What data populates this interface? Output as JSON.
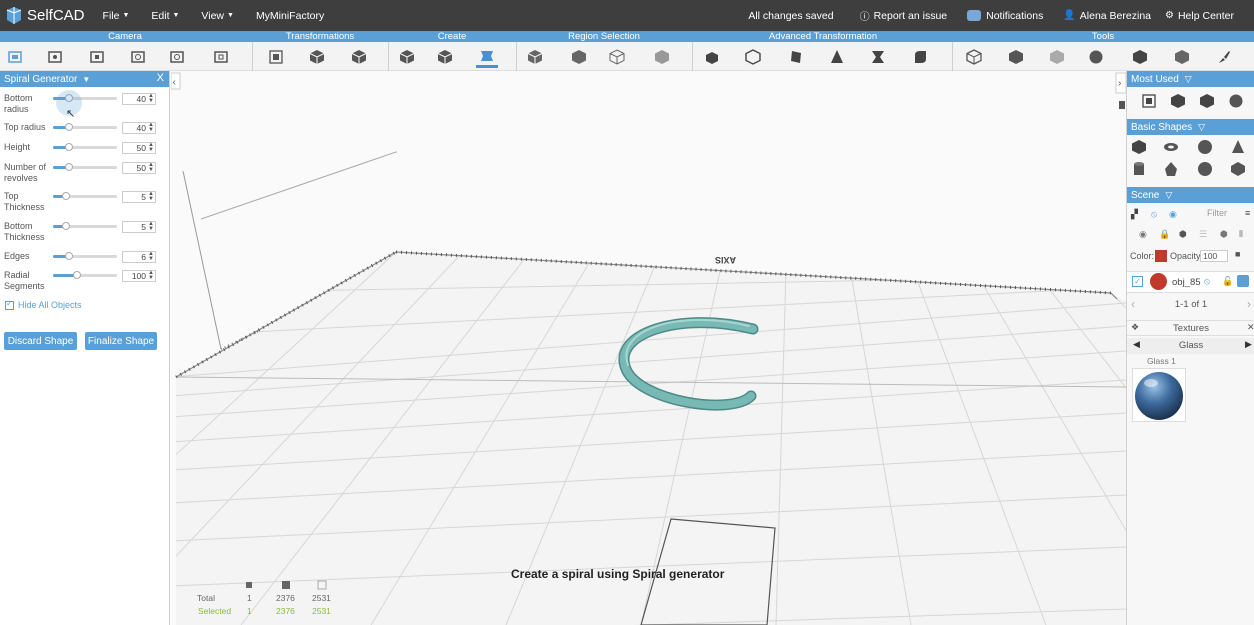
{
  "app": {
    "name": "SelfCAD"
  },
  "menu": [
    {
      "label": "File"
    },
    {
      "label": "Edit"
    },
    {
      "label": "View"
    },
    {
      "label": "MyMiniFactory"
    }
  ],
  "topright": {
    "saved": "All changes saved",
    "report": "Report an issue",
    "notifications": "Notifications",
    "user": "Alena Berezina",
    "help": "Help Center"
  },
  "categories": [
    "Camera",
    "Transformations",
    "Create",
    "Region Selection",
    "Advanced Transformation",
    "Tools"
  ],
  "left_panel": {
    "title": "Spiral Generator",
    "close": "X",
    "params": [
      {
        "label": "Bottom radius",
        "value": "40",
        "fill": 0.25
      },
      {
        "label": "Top radius",
        "value": "40",
        "fill": 0.25
      },
      {
        "label": "Height",
        "value": "50",
        "fill": 0.25
      },
      {
        "label": "Number of revolves",
        "value": "50",
        "fill": 0.25
      },
      {
        "label": "Top Thickness",
        "value": "5",
        "fill": 0.2
      },
      {
        "label": "Bottom Thickness",
        "value": "5",
        "fill": 0.2
      },
      {
        "label": "Edges",
        "value": "6",
        "fill": 0.25
      },
      {
        "label": "Radial Segments",
        "value": "100",
        "fill": 0.38
      }
    ],
    "hide_all": "Hide All Objects",
    "discard": "Discard Shape",
    "finalize": "Finalize Shape"
  },
  "viewport": {
    "caption": "Create a spiral using Spiral generator",
    "stats": {
      "total_label": "Total",
      "selected_label": "Selected",
      "total": [
        "1",
        "2376",
        "2531"
      ],
      "selected": [
        "1",
        "2376",
        "2531"
      ]
    },
    "axis_label": "AXIS",
    "object_color": "#78b9b5"
  },
  "right_panel": {
    "most_used": "Most Used",
    "basic_shapes": "Basic Shapes",
    "scene": "Scene",
    "filter_placeholder": "Filter",
    "color_label": "Color:",
    "opacity_label": "Opacity:",
    "opacity_value": "100",
    "object_name": "obj_85",
    "pagination": "1-1 of 1",
    "textures": "Textures",
    "material": "Glass",
    "material_item": "Glass 1",
    "object_swatch": "#c0392b"
  }
}
